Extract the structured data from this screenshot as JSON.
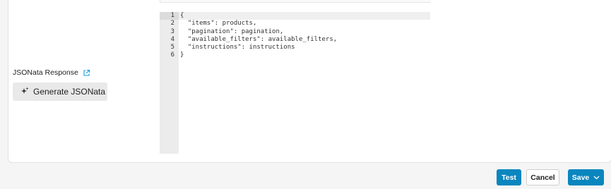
{
  "jsonata": {
    "label": "JSONata Response",
    "generate_button": "Generate JSONata"
  },
  "editor": {
    "line_numbers": [
      "1",
      "2",
      "3",
      "4",
      "5",
      "6"
    ],
    "lines": [
      "{",
      "  \"items\": products,",
      "  \"pagination\": pagination,",
      "  \"available_filters\": available_filters,",
      "  \"instructions\": instructions",
      "}"
    ]
  },
  "footer": {
    "test_label": "Test",
    "cancel_label": "Cancel",
    "save_label": "Save"
  },
  "colors": {
    "accent": "#0a86bf",
    "link_icon": "#1a9ad6"
  },
  "icons": {
    "external_link": "external-link-icon",
    "sparkle": "sparkle-icon",
    "chevron": "chevron-down-icon"
  }
}
